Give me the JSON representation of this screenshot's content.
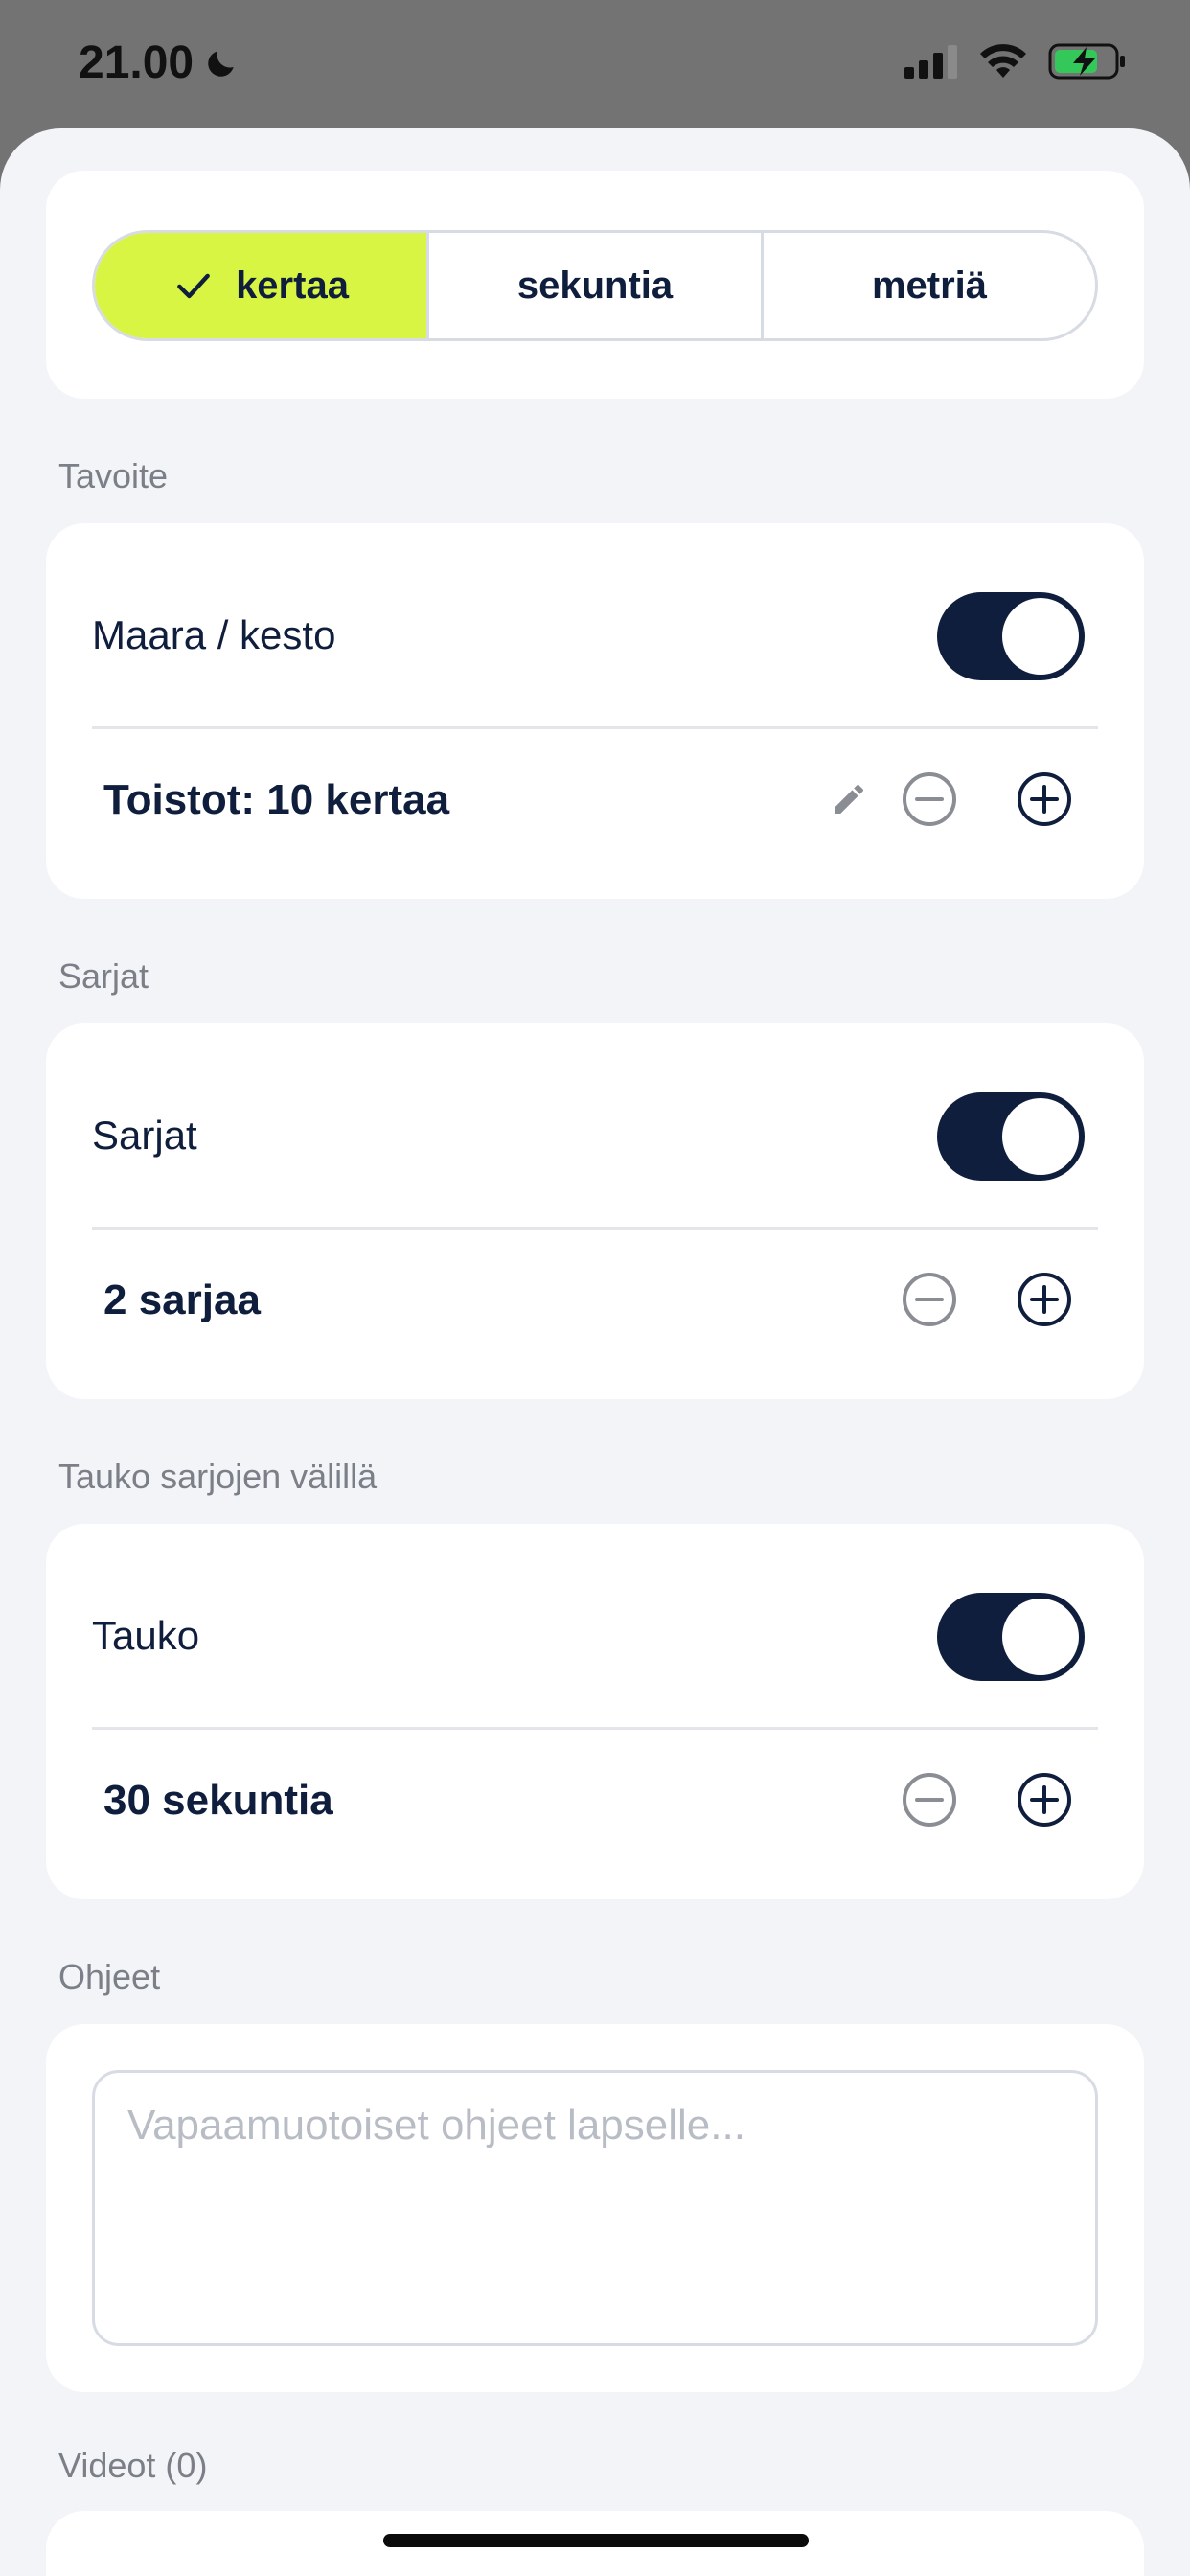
{
  "status": {
    "time": "21.00",
    "moon_icon": "moon-icon",
    "signal_icon": "cellular-signal-icon",
    "wifi_icon": "wifi-icon",
    "battery_icon": "battery-charging-icon"
  },
  "segments": [
    {
      "label": "kertaa",
      "selected": true
    },
    {
      "label": "sekuntia",
      "selected": false
    },
    {
      "label": "metriä",
      "selected": false
    }
  ],
  "goal": {
    "section_label": "Tavoite",
    "toggle_label": "Maara / kesto",
    "toggle_on": true,
    "value": "Toistot: 10 kertaa"
  },
  "sets": {
    "section_label": "Sarjat",
    "toggle_label": "Sarjat",
    "toggle_on": true,
    "value": "2 sarjaa"
  },
  "rest": {
    "section_label": "Tauko sarjojen välillä",
    "toggle_label": "Tauko",
    "toggle_on": true,
    "value": "30 sekuntia"
  },
  "instructions": {
    "section_label": "Ohjeet",
    "placeholder": "Vapaamuotoiset ohjeet lapselle...",
    "value": ""
  },
  "videos": {
    "section_label": "Videot (0)"
  },
  "colors": {
    "accent": "#d7f542",
    "navy": "#0f1e3d",
    "background": "#f3f4f8"
  }
}
